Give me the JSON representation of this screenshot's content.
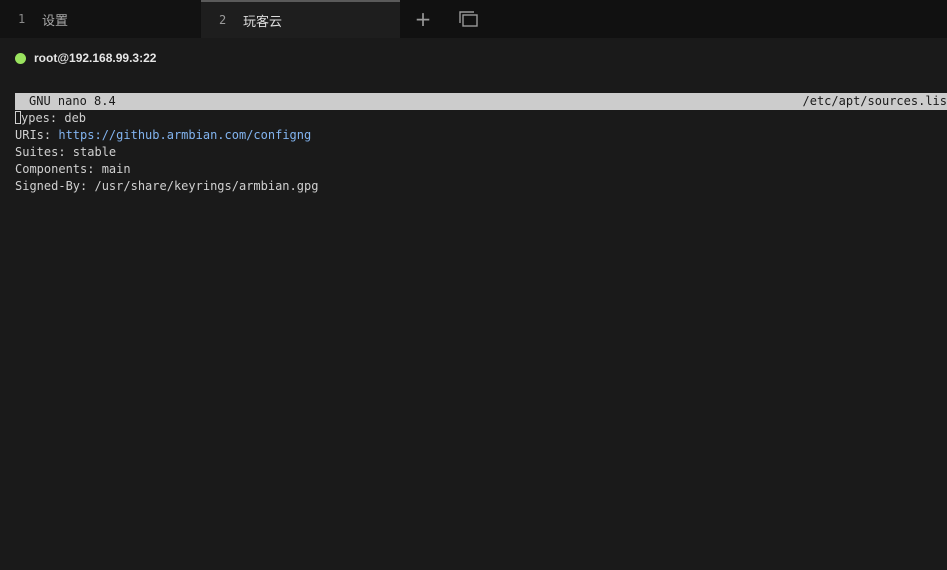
{
  "tabs": [
    {
      "number": "1",
      "label": "设置",
      "active": false
    },
    {
      "number": "2",
      "label": "玩客云",
      "active": true
    }
  ],
  "tab_actions": {
    "add_icon": "plus-icon",
    "add_glyph": "+",
    "window_icon": "windows-icon"
  },
  "session": {
    "label": "root@192.168.99.3:22",
    "status_color": "#9ae35f"
  },
  "nano": {
    "title": "GNU nano 8.4",
    "file": "/etc/apt/sources.lis"
  },
  "file_lines": [
    {
      "prefix": "Types: deb",
      "url": ""
    },
    {
      "prefix": "URIs: ",
      "url": "https://github.armbian.com/configng"
    },
    {
      "prefix": "Suites: stable",
      "url": ""
    },
    {
      "prefix": "Components: main",
      "url": ""
    },
    {
      "prefix": "Signed-By: /usr/share/keyrings/armbian.gpg",
      "url": ""
    }
  ]
}
